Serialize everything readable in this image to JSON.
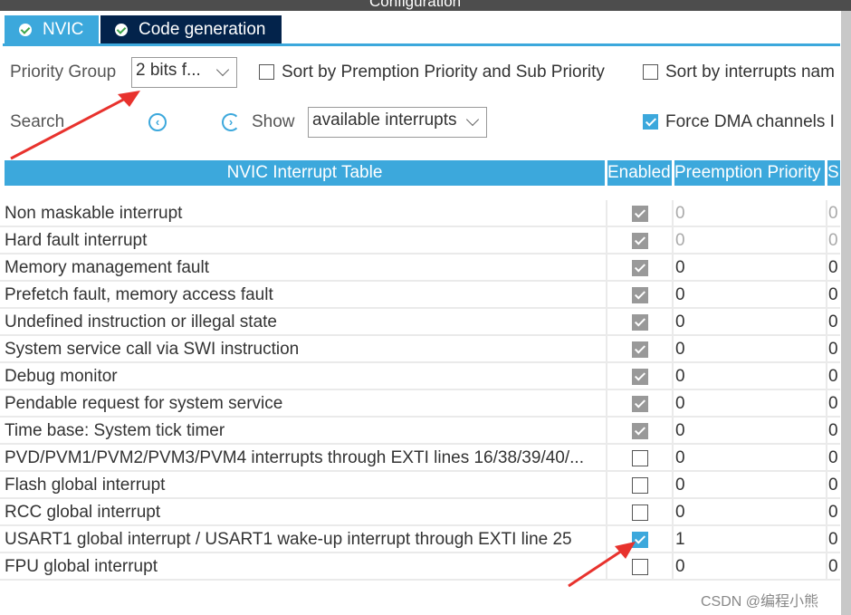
{
  "window_title": "Configuration",
  "tabs": [
    {
      "label": "NVIC",
      "active": true
    },
    {
      "label": "Code generation",
      "active": false
    }
  ],
  "priority_group": {
    "label": "Priority Group",
    "value": "2 bits f..."
  },
  "sort_premption": {
    "label": "Sort by Premption Priority and Sub Priority",
    "checked": false
  },
  "sort_interrupts": {
    "label": "Sort by interrupts nam",
    "checked": false
  },
  "search": {
    "label": "Search",
    "prev_icon": "circle-left-icon",
    "next_icon": "circle-right-icon"
  },
  "show": {
    "label": "Show",
    "value": "available interrupts"
  },
  "force_dma": {
    "label": "Force DMA channels I",
    "checked": true
  },
  "table": {
    "headers": [
      "NVIC Interrupt Table",
      "Enabled",
      "Preemption Priority",
      "S"
    ],
    "rows": [
      {
        "name": "Non maskable interrupt",
        "enabled": "locked",
        "pre": "0",
        "sub": "0",
        "disabled_vals": true
      },
      {
        "name": "Hard fault interrupt",
        "enabled": "locked",
        "pre": "0",
        "sub": "0",
        "disabled_vals": true
      },
      {
        "name": "Memory management fault",
        "enabled": "locked",
        "pre": "0",
        "sub": "0"
      },
      {
        "name": "Prefetch fault, memory access fault",
        "enabled": "locked",
        "pre": "0",
        "sub": "0"
      },
      {
        "name": "Undefined instruction or illegal state",
        "enabled": "locked",
        "pre": "0",
        "sub": "0"
      },
      {
        "name": "System service call via SWI instruction",
        "enabled": "locked",
        "pre": "0",
        "sub": "0"
      },
      {
        "name": "Debug monitor",
        "enabled": "locked",
        "pre": "0",
        "sub": "0"
      },
      {
        "name": "Pendable request for system service",
        "enabled": "locked",
        "pre": "0",
        "sub": "0"
      },
      {
        "name": "Time base: System tick timer",
        "enabled": "locked",
        "pre": "0",
        "sub": "0"
      },
      {
        "name": "PVD/PVM1/PVM2/PVM3/PVM4 interrupts through EXTI lines 16/38/39/40/...",
        "enabled": "off",
        "pre": "0",
        "sub": "0"
      },
      {
        "name": "Flash global interrupt",
        "enabled": "off",
        "pre": "0",
        "sub": "0"
      },
      {
        "name": "RCC global interrupt",
        "enabled": "off",
        "pre": "0",
        "sub": "0"
      },
      {
        "name": "USART1 global interrupt / USART1 wake-up interrupt through EXTI line 25",
        "enabled": "on",
        "pre": "1",
        "sub": "0"
      },
      {
        "name": "FPU global interrupt",
        "enabled": "off",
        "pre": "0",
        "sub": "0"
      }
    ]
  },
  "watermark": "CSDN @编程小熊",
  "colors": {
    "accent": "#3ca8dc",
    "tab_dark": "#03234b",
    "annotation_arrow": "#e8322d"
  }
}
